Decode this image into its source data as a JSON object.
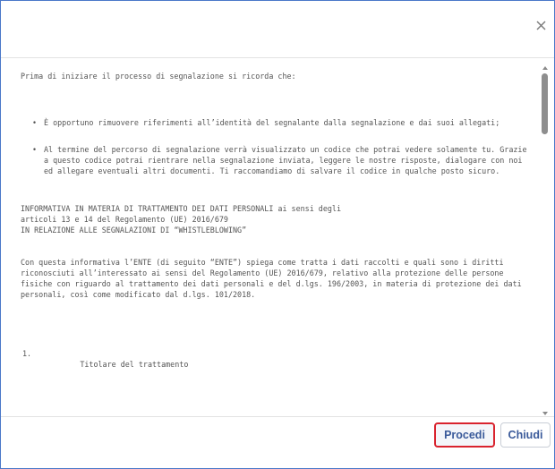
{
  "dialog": {
    "close_icon": "close-icon",
    "intro": "Prima di iniziare il processo di segnalazione si ricorda che:",
    "bullets": [
      "È opportuno rimuovere riferimenti all’identità del segnalante dalla segnalazione e dai suoi allegati;",
      "Al termine del percorso di segnalazione verrà visualizzato un codice che potrai vedere solamente tu. Grazie a questo codice potrai rientrare nella segnalazione inviata, leggere le nostre risposte, dialogare con noi ed allegare eventuali altri documenti. Ti raccomandiamo di salvare il codice in qualche posto sicuro."
    ],
    "informativa_line1": "INFORMATIVA IN MATERIA DI TRATTAMENTO DEI DATI PERSONALI ai sensi degli",
    "informativa_line2": "articoli 13 e 14 del Regolamento (UE) 2016/679",
    "informativa_line3": "IN RELAZIONE ALLE SEGNALAZIONI DI “WHISTLEBLOWING”",
    "paragraph": "Con questa informativa l’ENTE (di seguito “ENTE”) spiega come tratta i dati raccolti e quali sono i diritti riconosciuti all’interessato ai sensi del Regolamento (UE) 2016/679, relativo alla protezione delle persone fisiche con riguardo al trattamento dei dati personali e del d.lgs. 196/2003, in materia di protezione dei dati personali, così come modificato dal d.lgs. 101/2018.",
    "section_number": "1.",
    "section_title": "Titolare del trattamento"
  },
  "footer": {
    "proceed_label": "Procedi",
    "close_label": "Chiudi"
  },
  "colors": {
    "dialog_border": "#4a78c9",
    "button_text": "#3a5a9a",
    "highlight_border": "#d9232e",
    "body_text": "#555555"
  }
}
